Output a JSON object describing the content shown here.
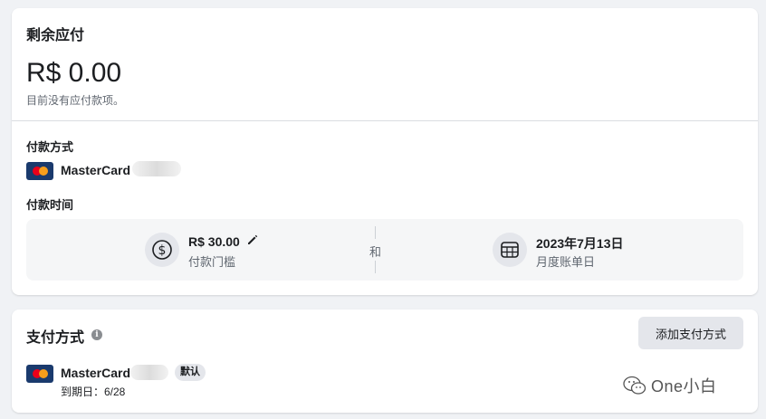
{
  "balance": {
    "title": "剩余应付",
    "amount": "R$ 0.00",
    "note": "目前没有应付款项。"
  },
  "payment_method_section": {
    "label": "付款方式",
    "card_brand": "MasterCard"
  },
  "payment_schedule": {
    "label": "付款时间",
    "threshold": {
      "value": "R$ 30.00",
      "label": "付款门槛",
      "icon": "dollar-circle-icon"
    },
    "connector": "和",
    "billing_date": {
      "value": "2023年7月13日",
      "label": "月度账单日",
      "icon": "calendar-icon"
    }
  },
  "payment_methods": {
    "title": "支付方式",
    "add_button": "添加支付方式",
    "items": [
      {
        "brand": "MasterCard",
        "badge": "默认",
        "expiry_label": "到期日：6/28"
      }
    ]
  },
  "watermark": {
    "text": "One小白"
  },
  "colors": {
    "background": "#f0f2f5",
    "card": "#ffffff",
    "mastercard_blue": "#1a3a6d",
    "mastercard_red": "#eb001b",
    "mastercard_orange": "#f79e1b"
  }
}
